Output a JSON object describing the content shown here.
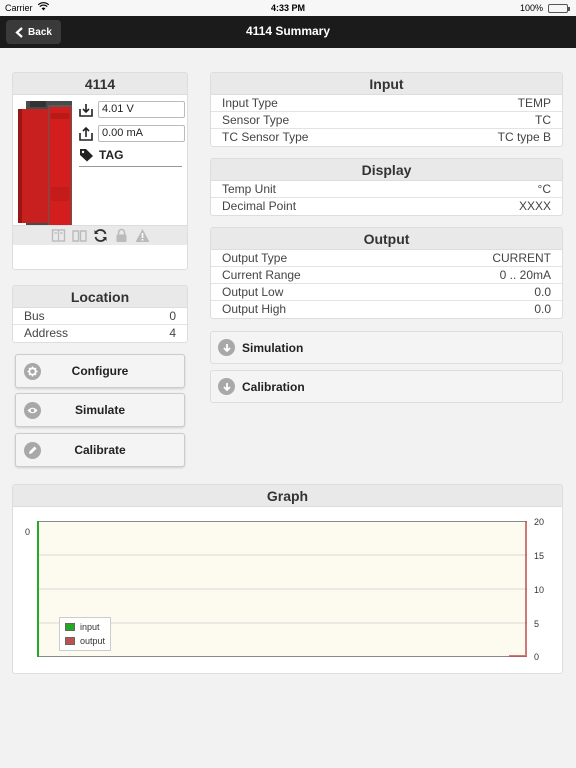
{
  "status_bar": {
    "carrier": "Carrier",
    "time": "4:33 PM",
    "battery": "100%"
  },
  "nav": {
    "back_label": "Back",
    "title": "4114 Summary"
  },
  "device": {
    "title": "4114",
    "input_value": "4.01 V",
    "output_value": "0.00 mA",
    "tag": "TAG"
  },
  "location": {
    "title": "Location",
    "rows": [
      {
        "label": "Bus",
        "value": "0"
      },
      {
        "label": "Address",
        "value": "4"
      }
    ]
  },
  "actions": {
    "configure": "Configure",
    "simulate": "Simulate",
    "calibrate": "Calibrate"
  },
  "input": {
    "title": "Input",
    "rows": [
      {
        "label": "Input Type",
        "value": "TEMP"
      },
      {
        "label": "Sensor Type",
        "value": "TC"
      },
      {
        "label": "TC Sensor Type",
        "value": "TC type B"
      }
    ]
  },
  "display": {
    "title": "Display",
    "rows": [
      {
        "label": "Temp Unit",
        "value": "°C"
      },
      {
        "label": "Decimal Point",
        "value": "XXXX"
      }
    ]
  },
  "output": {
    "title": "Output",
    "rows": [
      {
        "label": "Output Type",
        "value": "CURRENT"
      },
      {
        "label": "Current Range",
        "value": "0 .. 20mA"
      },
      {
        "label": "Output Low",
        "value": "0.0"
      },
      {
        "label": "Output High",
        "value": "0.0"
      }
    ]
  },
  "sections": {
    "simulation": "Simulation",
    "calibration": "Calibration"
  },
  "graph": {
    "title": "Graph",
    "left_axis_label": "0",
    "right_ticks": [
      "20",
      "15",
      "10",
      "5",
      "0"
    ],
    "legend": [
      {
        "name": "input",
        "color": "#22aa22"
      },
      {
        "name": "output",
        "color": "#c0504d"
      }
    ]
  },
  "colors": {
    "input_line": "#22aa22",
    "output_line": "#c0504d",
    "nav_bg": "#1b1b1b"
  }
}
